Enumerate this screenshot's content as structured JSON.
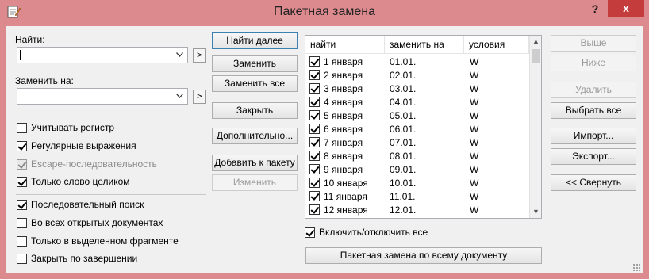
{
  "window": {
    "title": "Пакетная замена",
    "help_label": "?",
    "close_label": "x"
  },
  "find": {
    "label": "Найти:",
    "value": "",
    "more_label": ">"
  },
  "replace": {
    "label": "Заменить на:",
    "value": "",
    "more_label": ">"
  },
  "options": [
    {
      "label": "Учитывать регистр",
      "checked": false,
      "enabled": true
    },
    {
      "label": "Регулярные выражения",
      "checked": true,
      "enabled": true
    },
    {
      "label": "Escape-последовательность",
      "checked": true,
      "enabled": false
    },
    {
      "label": "Только слово целиком",
      "checked": true,
      "enabled": true
    }
  ],
  "scope_options": [
    {
      "label": "Последовательный поиск",
      "checked": true
    },
    {
      "label": "Во всех открытых документах",
      "checked": false
    },
    {
      "label": "Только в выделенном фрагменте",
      "checked": false
    },
    {
      "label": "Закрыть по завершении",
      "checked": false
    }
  ],
  "buttons": {
    "find_next": "Найти далее",
    "replace": "Заменить",
    "replace_all": "Заменить все",
    "close": "Закрыть",
    "more": "Дополнительно...",
    "add_to_batch": "Добавить к пакету",
    "modify": "Изменить"
  },
  "list": {
    "columns": [
      "найти",
      "заменить на",
      "условия"
    ],
    "rows": [
      {
        "find": "1 января",
        "replace": "01.01.",
        "cond": "W",
        "checked": true
      },
      {
        "find": "2 января",
        "replace": "02.01.",
        "cond": "W",
        "checked": true
      },
      {
        "find": "3 января",
        "replace": "03.01.",
        "cond": "W",
        "checked": true
      },
      {
        "find": "4 января",
        "replace": "04.01.",
        "cond": "W",
        "checked": true
      },
      {
        "find": "5 января",
        "replace": "05.01.",
        "cond": "W",
        "checked": true
      },
      {
        "find": "6 января",
        "replace": "06.01.",
        "cond": "W",
        "checked": true
      },
      {
        "find": "7 января",
        "replace": "07.01.",
        "cond": "W",
        "checked": true
      },
      {
        "find": "8 января",
        "replace": "08.01.",
        "cond": "W",
        "checked": true
      },
      {
        "find": "9 января",
        "replace": "09.01.",
        "cond": "W",
        "checked": true
      },
      {
        "find": "10 января",
        "replace": "10.01.",
        "cond": "W",
        "checked": true
      },
      {
        "find": "11 января",
        "replace": "11.01.",
        "cond": "W",
        "checked": true
      },
      {
        "find": "12 января",
        "replace": "12.01.",
        "cond": "W",
        "checked": true
      }
    ]
  },
  "toggle_all": {
    "label": "Включить/отключить все",
    "checked": true
  },
  "batch_whole_doc": "Пакетная замена по всему документу",
  "side_buttons": {
    "up": "Выше",
    "down": "Ниже",
    "delete": "Удалить",
    "select_all": "Выбрать все",
    "import": "Импорт...",
    "export": "Экспорт...",
    "collapse": "<< Свернуть"
  },
  "colors": {
    "titlebar": "#dc8a8e",
    "close_button": "#c43c3c",
    "client": "#f0f0f0"
  }
}
